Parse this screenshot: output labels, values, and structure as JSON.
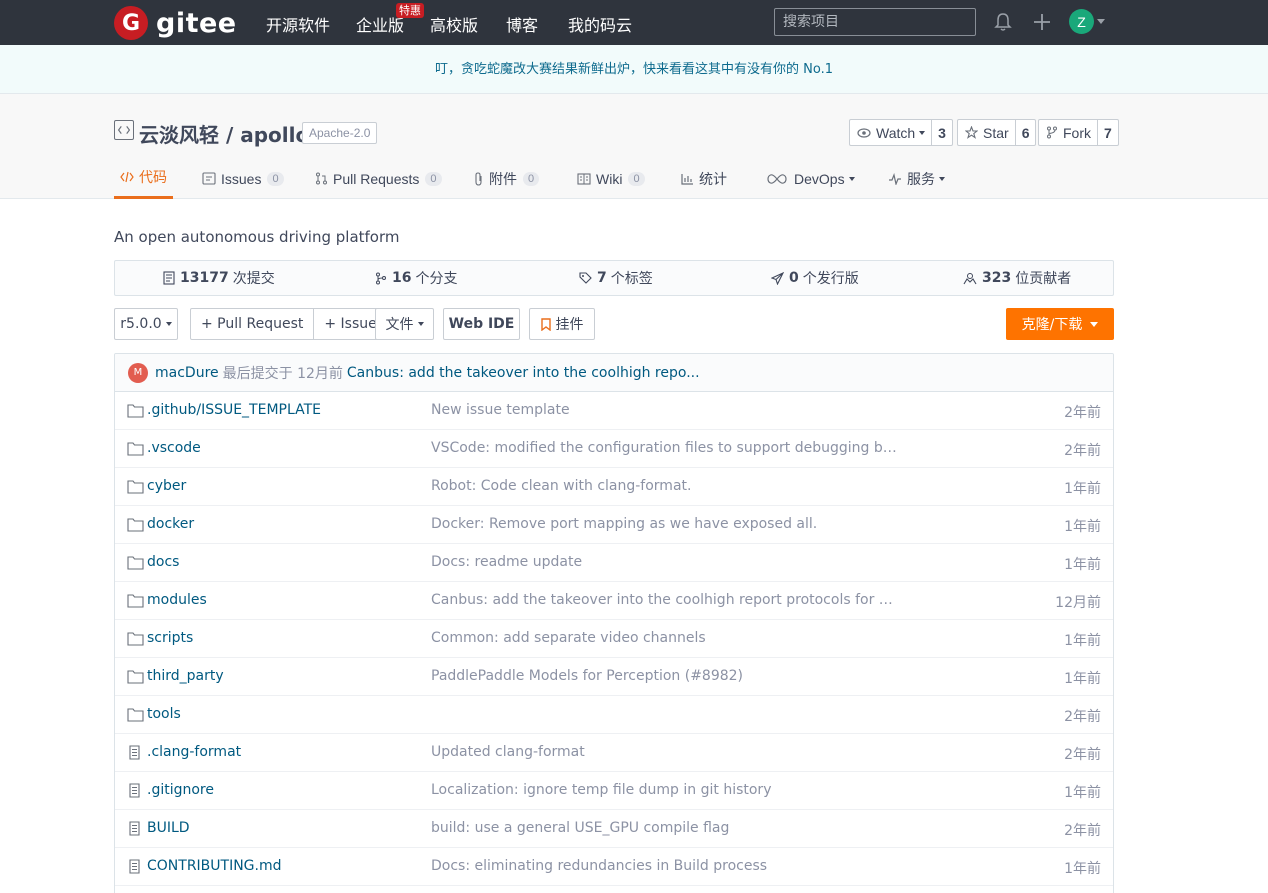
{
  "nav": {
    "logo_mark": "G",
    "logo_text": "gitee",
    "items": [
      "开源软件",
      "企业版",
      "高校版",
      "博客",
      "我的码云"
    ],
    "badge": "特惠",
    "search_placeholder": "搜索项目",
    "avatar_letter": "Z"
  },
  "notice": "叮，贪吃蛇魔改大赛结果新鲜出炉，快来看看这其中有没有你的 No.1",
  "repo": {
    "owner": "云淡风轻",
    "separator": " / ",
    "name": "apollo",
    "license": "Apache-2.0",
    "watch": {
      "label": "Watch",
      "count": "3"
    },
    "star": {
      "label": "Star",
      "count": "6"
    },
    "fork": {
      "label": "Fork",
      "count": "7"
    }
  },
  "tabs": [
    {
      "label": "代码"
    },
    {
      "label": "Issues",
      "count": "0"
    },
    {
      "label": "Pull Requests",
      "count": "0"
    },
    {
      "label": "附件",
      "count": "0"
    },
    {
      "label": "Wiki",
      "count": "0"
    },
    {
      "label": "统计"
    },
    {
      "label": "DevOps"
    },
    {
      "label": "服务"
    }
  ],
  "description": "An open autonomous driving platform",
  "stats": [
    {
      "num": "13177",
      "label": "次提交"
    },
    {
      "num": "16",
      "label": "个分支"
    },
    {
      "num": "7",
      "label": "个标签"
    },
    {
      "num": "0",
      "label": "个发行版"
    },
    {
      "num": "323",
      "label": "位贡献者"
    }
  ],
  "toolbar": {
    "branch": "r5.0.0",
    "pull_request": "+ Pull Request",
    "issue": "+ Issue",
    "file": "文件",
    "web_ide": "Web IDE",
    "widget": "挂件",
    "clone": "克隆/下载"
  },
  "commit": {
    "avatar": "M",
    "author": "macDure",
    "time": "最后提交于 12月前",
    "message": "Canbus: add the takeover into the coolhigh repo..."
  },
  "files": [
    {
      "type": "folder",
      "name": ".github/ISSUE_TEMPLATE",
      "message": "New issue template",
      "time": "2年前"
    },
    {
      "type": "folder",
      "name": ".vscode",
      "message": "VSCode: modified the configuration files to support debugging based on...",
      "time": "2年前"
    },
    {
      "type": "folder",
      "name": "cyber",
      "message": "Robot: Code clean with clang-format.",
      "time": "1年前"
    },
    {
      "type": "folder",
      "name": "docker",
      "message": "Docker: Remove port mapping as we have exposed all.",
      "time": "1年前"
    },
    {
      "type": "folder",
      "name": "docs",
      "message": "Docs: readme update",
      "time": "1年前"
    },
    {
      "type": "folder",
      "name": "modules",
      "message": "Canbus: add the takeover into the coolhigh report protocols for master",
      "time": "12月前"
    },
    {
      "type": "folder",
      "name": "scripts",
      "message": "Common: add separate video channels",
      "time": "1年前"
    },
    {
      "type": "folder",
      "name": "third_party",
      "message": "PaddlePaddle Models for Perception (#8982)",
      "time": "1年前"
    },
    {
      "type": "folder",
      "name": "tools",
      "message": "",
      "time": "2年前"
    },
    {
      "type": "file",
      "name": ".clang-format",
      "message": "Updated clang-format",
      "time": "2年前"
    },
    {
      "type": "file",
      "name": ".gitignore",
      "message": "Localization: ignore temp file dump in git history",
      "time": "1年前"
    },
    {
      "type": "file",
      "name": "BUILD",
      "message": "build: use a general USE_GPU compile flag",
      "time": "2年前"
    },
    {
      "type": "file",
      "name": "CONTRIBUTING.md",
      "message": "Docs: eliminating redundancies in Build process",
      "time": "1年前"
    }
  ]
}
